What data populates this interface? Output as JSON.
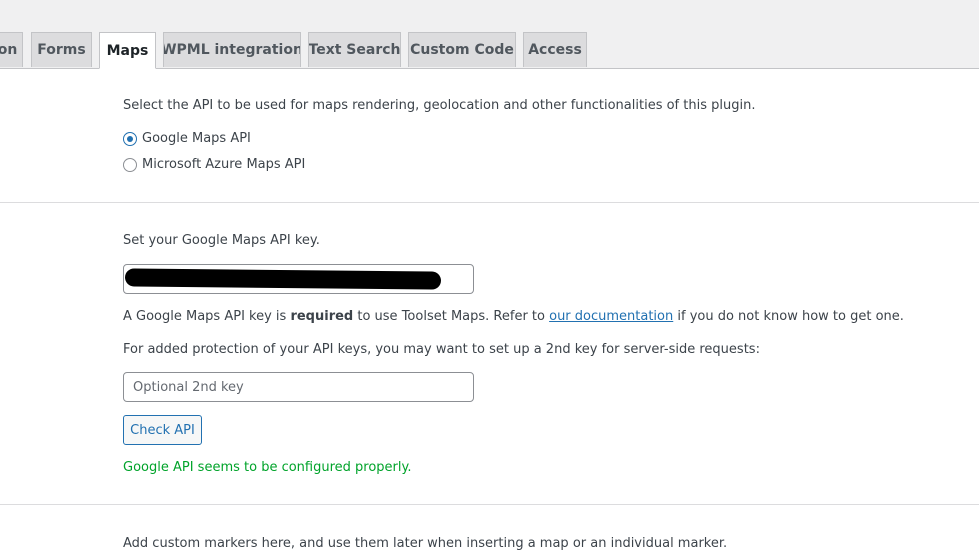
{
  "tabs": [
    {
      "label": "on",
      "active": false
    },
    {
      "label": "Forms",
      "active": false
    },
    {
      "label": "Maps",
      "active": true
    },
    {
      "label": "WPML integration",
      "active": false
    },
    {
      "label": "Text Search",
      "active": false
    },
    {
      "label": "Custom Code",
      "active": false
    },
    {
      "label": "Access",
      "active": false
    }
  ],
  "api_section": {
    "description": "Select the API to be used for maps rendering, geolocation and other functionalities of this plugin.",
    "options": [
      {
        "label": "Google Maps API",
        "checked": true
      },
      {
        "label": "Microsoft Azure Maps API",
        "checked": false
      }
    ]
  },
  "key_section": {
    "set_key_label": "Set your Google Maps API key.",
    "api_key_value": "",
    "required_note": {
      "before": "A Google Maps API key is ",
      "bold": "required",
      "middle": " to use Toolset Maps. Refer to ",
      "link": "our documentation",
      "after": " if you do not know how to get one."
    },
    "protection_note": "For added protection of your API keys, you may want to set up a 2nd key for server-side requests:",
    "second_key_placeholder": "Optional 2nd key",
    "check_button": "Check API",
    "status": "Google API seems to be configured properly."
  },
  "markers_section": {
    "description": "Add custom markers here, and use them later when inserting a map or an individual marker."
  },
  "colors": {
    "accent": "#2271b1",
    "success": "#00a32a"
  }
}
